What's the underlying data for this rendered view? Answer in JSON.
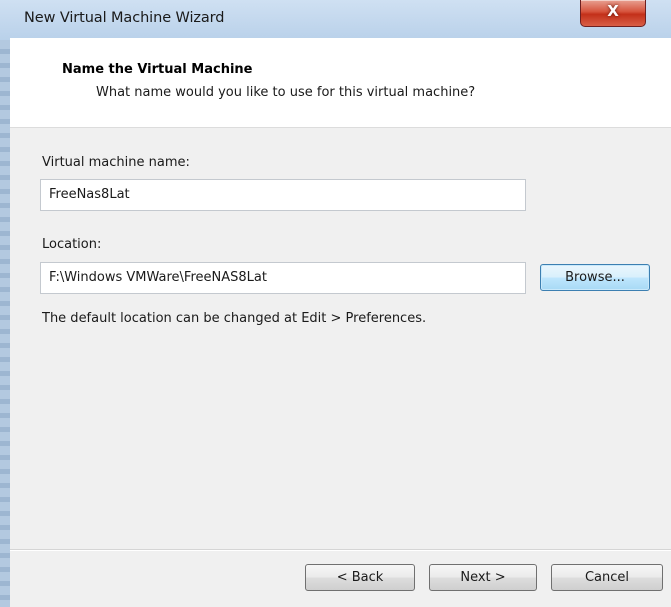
{
  "window": {
    "title": "New Virtual Machine Wizard",
    "close_glyph": "X"
  },
  "header": {
    "title": "Name the Virtual Machine",
    "subtitle": "What name would you like to use for this virtual machine?"
  },
  "form": {
    "name_label": "Virtual machine name:",
    "name_value": "FreeNas8Lat",
    "location_label": "Location:",
    "location_value": "F:\\Windows VMWare\\FreeNAS8Lat",
    "browse_label": "Browse...",
    "hint": "The default location can be changed at Edit > Preferences."
  },
  "footer": {
    "back_label": "< Back",
    "next_label": "Next >",
    "cancel_label": "Cancel"
  },
  "colors": {
    "close_button": "#c3301a",
    "focus_button": "#3c7fb1",
    "client_background": "#f0f0f0"
  }
}
